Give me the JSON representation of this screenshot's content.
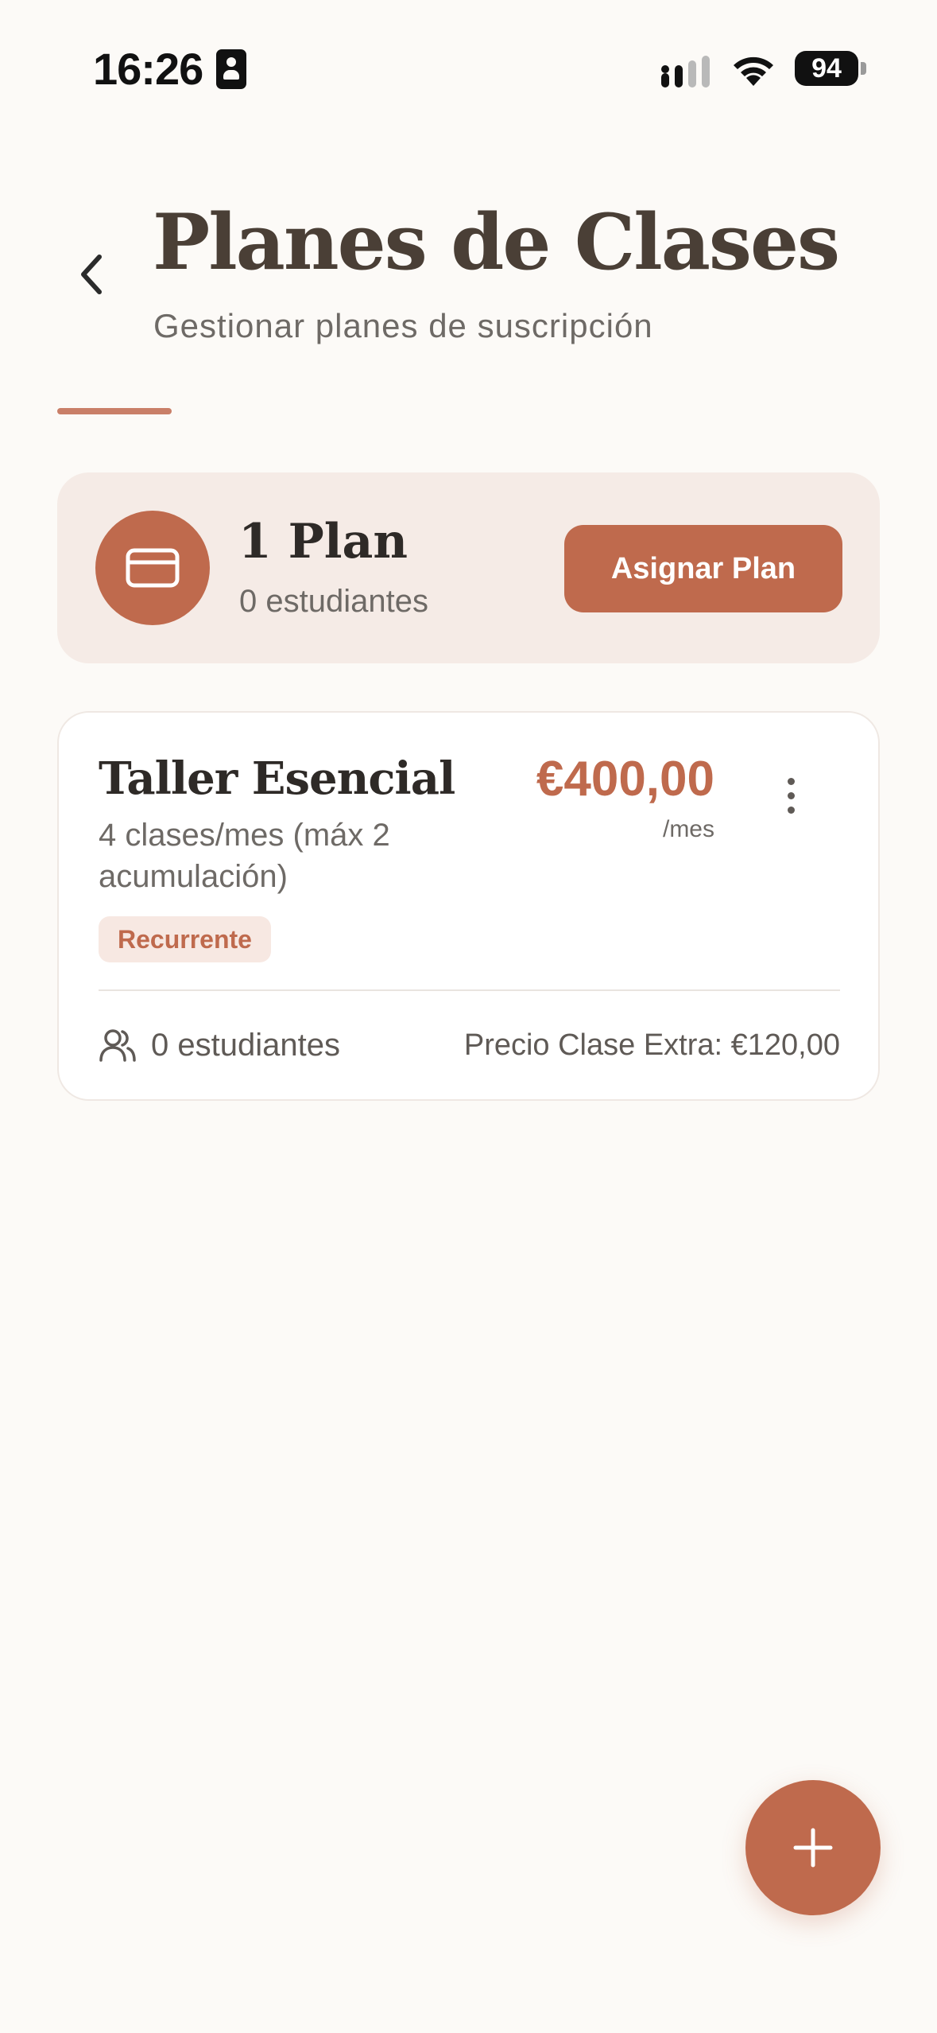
{
  "status_bar": {
    "time": "16:26",
    "battery": "94",
    "icons": [
      "sim-card-icon",
      "signal-icon",
      "wifi-icon",
      "battery-icon"
    ]
  },
  "header": {
    "title": "Planes de Clases",
    "subtitle": "Gestionar planes de suscripción",
    "back_icon": "chevron-left-icon"
  },
  "summary": {
    "count_label": "1 Plan",
    "students_label": "0 estudiantes",
    "assign_button": "Asignar Plan",
    "icon": "credit-card-icon"
  },
  "plans": [
    {
      "name": "Taller Esencial",
      "description": "4 clases/mes (máx 2 acumulación)",
      "price": "€400,00",
      "period": "/mes",
      "badge": "Recurrente",
      "students": "0 estudiantes",
      "extra_price": "Precio Clase Extra: €120,00",
      "menu_icon": "more-vertical-icon",
      "students_icon": "users-icon"
    }
  ],
  "fab": {
    "icon": "plus-icon"
  },
  "colors": {
    "accent": "#bf6a4d",
    "accent_light": "#f5ebe6",
    "background": "#fcfaf7",
    "title": "#4a3f36",
    "muted_text": "#6e6a66"
  }
}
